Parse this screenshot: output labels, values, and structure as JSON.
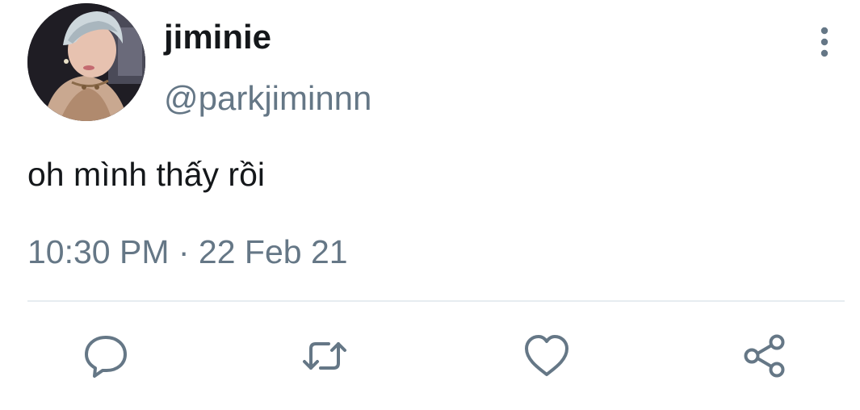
{
  "tweet": {
    "display_name": "jiminie",
    "handle": "@parkjiminnn",
    "text": "oh mình thấy rồi",
    "timestamp": "10:30 PM · 22 Feb 21"
  },
  "icons": {
    "more": "more-vertical-icon",
    "reply": "reply-bubble-icon",
    "retweet": "retweet-icon",
    "like": "heart-icon",
    "share": "share-icon"
  },
  "colors": {
    "text_primary": "#14171a",
    "text_secondary": "#657786",
    "icon": "#657786",
    "divider": "#e6ecf0"
  }
}
